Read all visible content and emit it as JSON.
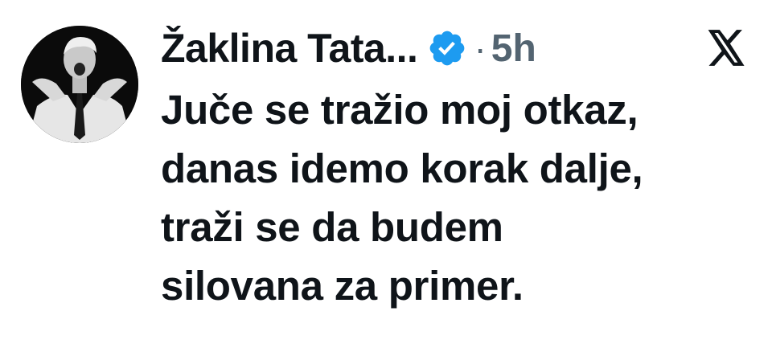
{
  "tweet": {
    "author_name": "Žaklina Tata...",
    "separator": "·",
    "time": "5h",
    "verified_icon": "verified-badge-icon",
    "platform_icon": "x-logo-icon",
    "text_lines": [
      "Juče se tražio moj otkaz,",
      "danas idemo korak dalje,",
      "traži se da budem",
      "silovana za primer."
    ]
  },
  "colors": {
    "text": "#0f1419",
    "muted": "#536471",
    "verified": "#1d9bf0",
    "background": "#ffffff"
  }
}
